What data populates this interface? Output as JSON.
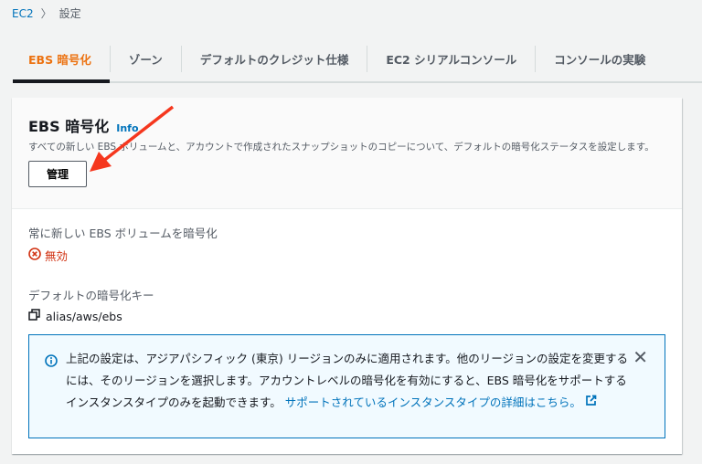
{
  "breadcrumb": {
    "root": "EC2",
    "current": "設定"
  },
  "tabs": [
    "EBS 暗号化",
    "ゾーン",
    "デフォルトのクレジット仕様",
    "EC2 シリアルコンソール",
    "コンソールの実験"
  ],
  "card": {
    "title": "EBS 暗号化",
    "info": "Info",
    "description": "すべての新しい EBS ボリュームと、アカウントで作成されたスナップショットのコピーについて、デフォルトの暗号化ステータスを設定します。",
    "manage_label": "管理",
    "always_encrypt_label": "常に新しい EBS ボリュームを暗号化",
    "always_encrypt_value": "無効",
    "default_key_label": "デフォルトの暗号化キー",
    "default_key_value": "alias/aws/ebs"
  },
  "alert": {
    "text": "上記の設定は、アジアパシフィック (東京) リージョンのみに適用されます。他のリージョンの設定を変更するには、そのリージョンを選択します。アカウントレベルの暗号化を有効にすると、EBS 暗号化をサポートするインスタンスタイプのみを起動できます。",
    "link": "サポートされているインスタンスタイプの詳細はこちら。"
  },
  "colors": {
    "accent": "#ec7211",
    "link": "#0073bb",
    "error": "#d13212",
    "annotation": "#f5371e"
  }
}
